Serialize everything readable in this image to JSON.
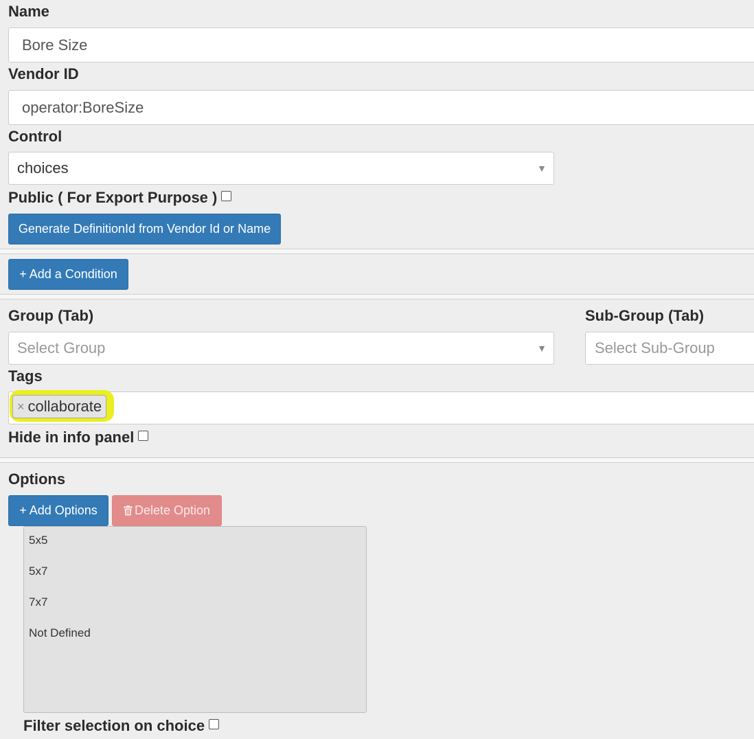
{
  "fields": {
    "name": {
      "label": "Name",
      "value": "Bore Size"
    },
    "vendor_id": {
      "label": "Vendor ID",
      "value": "operator:BoreSize"
    },
    "control": {
      "label": "Control",
      "value": "choices"
    },
    "public": {
      "label": "Public ( For Export Purpose )",
      "checked": false
    }
  },
  "buttons": {
    "generate": "Generate DefinitionId from Vendor Id or Name",
    "add_condition": "+ Add a Condition",
    "add_options": "+ Add Options",
    "delete_option": "Delete Option"
  },
  "group": {
    "label": "Group (Tab)",
    "placeholder": "Select Group"
  },
  "subgroup": {
    "label": "Sub-Group (Tab)",
    "placeholder": "Select Sub-Group"
  },
  "tags": {
    "label": "Tags",
    "items": [
      {
        "remove": "×",
        "text": "collaborate",
        "highlight": "#eaef1f"
      }
    ]
  },
  "hide_info": {
    "label": "Hide in info panel",
    "checked": false
  },
  "options": {
    "label": "Options",
    "items": [
      "5x5",
      "5x7",
      "7x7",
      "Not Defined"
    ]
  },
  "filter": {
    "label": "Filter selection on choice",
    "checked": false
  },
  "colors": {
    "primary": "#337ab7",
    "danger": "#e28b8b",
    "background": "#eeeeee"
  },
  "icons": {
    "caret": "chevron-down-icon",
    "trash": "trash-icon"
  }
}
